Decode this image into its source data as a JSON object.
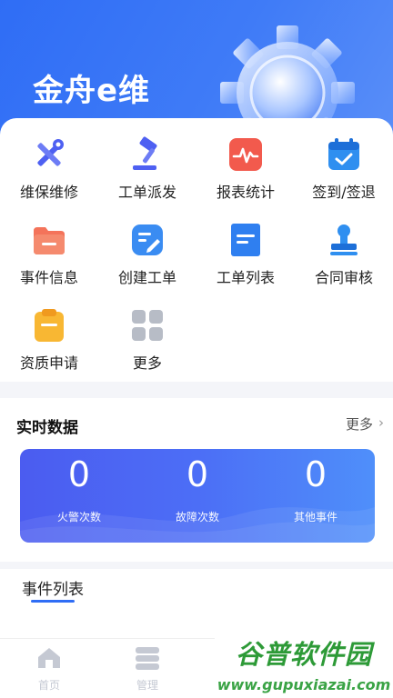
{
  "app": {
    "title": "金舟e维"
  },
  "grid": {
    "items": [
      {
        "label": "维保维修",
        "icon": "tools-icon"
      },
      {
        "label": "工单派发",
        "icon": "gavel-icon"
      },
      {
        "label": "报表统计",
        "icon": "pulse-chart-icon"
      },
      {
        "label": "签到/签退",
        "icon": "calendar-check-icon"
      },
      {
        "label": "事件信息",
        "icon": "folder-icon"
      },
      {
        "label": "创建工单",
        "icon": "edit-doc-icon"
      },
      {
        "label": "工单列表",
        "icon": "list-doc-icon"
      },
      {
        "label": "合同审核",
        "icon": "stamp-icon"
      },
      {
        "label": "资质申请",
        "icon": "clipboard-icon"
      },
      {
        "label": "更多",
        "icon": "grid-icon"
      }
    ]
  },
  "realtime": {
    "title": "实时数据",
    "more": "更多",
    "stats": [
      {
        "value": "0",
        "label": "火警次数"
      },
      {
        "value": "0",
        "label": "故障次数"
      },
      {
        "value": "0",
        "label": "其他事件"
      }
    ]
  },
  "events": {
    "title": "事件列表"
  },
  "tabbar": {
    "tabs": [
      {
        "label": "首页",
        "icon": "home-icon"
      },
      {
        "label": "管理",
        "icon": "database-icon"
      }
    ]
  },
  "watermark": {
    "line1": "谷普软件园",
    "line2": "www.gupuxiazai.com"
  },
  "colors": {
    "primary": "#2f6df5",
    "watermark": "#2d9a37"
  }
}
